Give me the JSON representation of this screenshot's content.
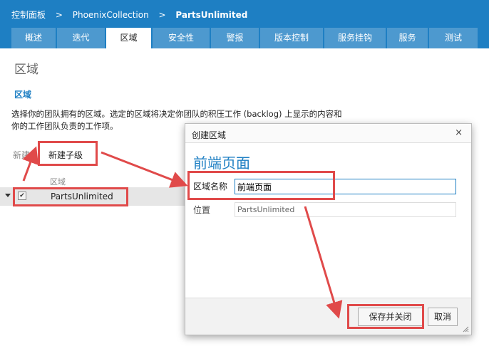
{
  "breadcrumb": {
    "items": [
      "控制面板",
      "PhoenixCollection",
      "PartsUnlimited"
    ],
    "separator": ">"
  },
  "tabs": [
    {
      "label": "概述",
      "active": false
    },
    {
      "label": "迭代",
      "active": false
    },
    {
      "label": "区域",
      "active": true
    },
    {
      "label": "安全性",
      "active": false
    },
    {
      "label": "警报",
      "active": false
    },
    {
      "label": "版本控制",
      "active": false
    },
    {
      "label": "服务挂钩",
      "active": false
    },
    {
      "label": "服务",
      "active": false
    },
    {
      "label": "测试",
      "active": false
    }
  ],
  "page": {
    "title": "区域",
    "section_link": "区域",
    "description": "选择你的团队拥有的区域。选定的区域将决定你团队的积压工作 (backlog) 上显示的内容和你的工作团队负责的工作项。"
  },
  "toolbar": {
    "new_label": "新建",
    "new_child_label": "新建子级"
  },
  "tree": {
    "column_header": "区域",
    "rows": [
      {
        "label": "PartsUnlimited",
        "checked": true
      }
    ]
  },
  "dialog": {
    "title": "创建区域",
    "close_glyph": "×",
    "heading": "前端页面",
    "name_label": "区域名称",
    "name_value": "前端页面",
    "location_label": "位置",
    "location_value": "PartsUnlimited",
    "save_label": "保存并关闭",
    "cancel_label": "取消"
  },
  "colors": {
    "brand": "#1e7fc3",
    "tab_inactive": "#4d99cf",
    "annotation": "#e04a4a"
  },
  "icons": {
    "close": "close-icon",
    "expander": "triangle-down-icon",
    "checkbox": "checkbox-icon",
    "resize": "resize-grip-icon"
  }
}
